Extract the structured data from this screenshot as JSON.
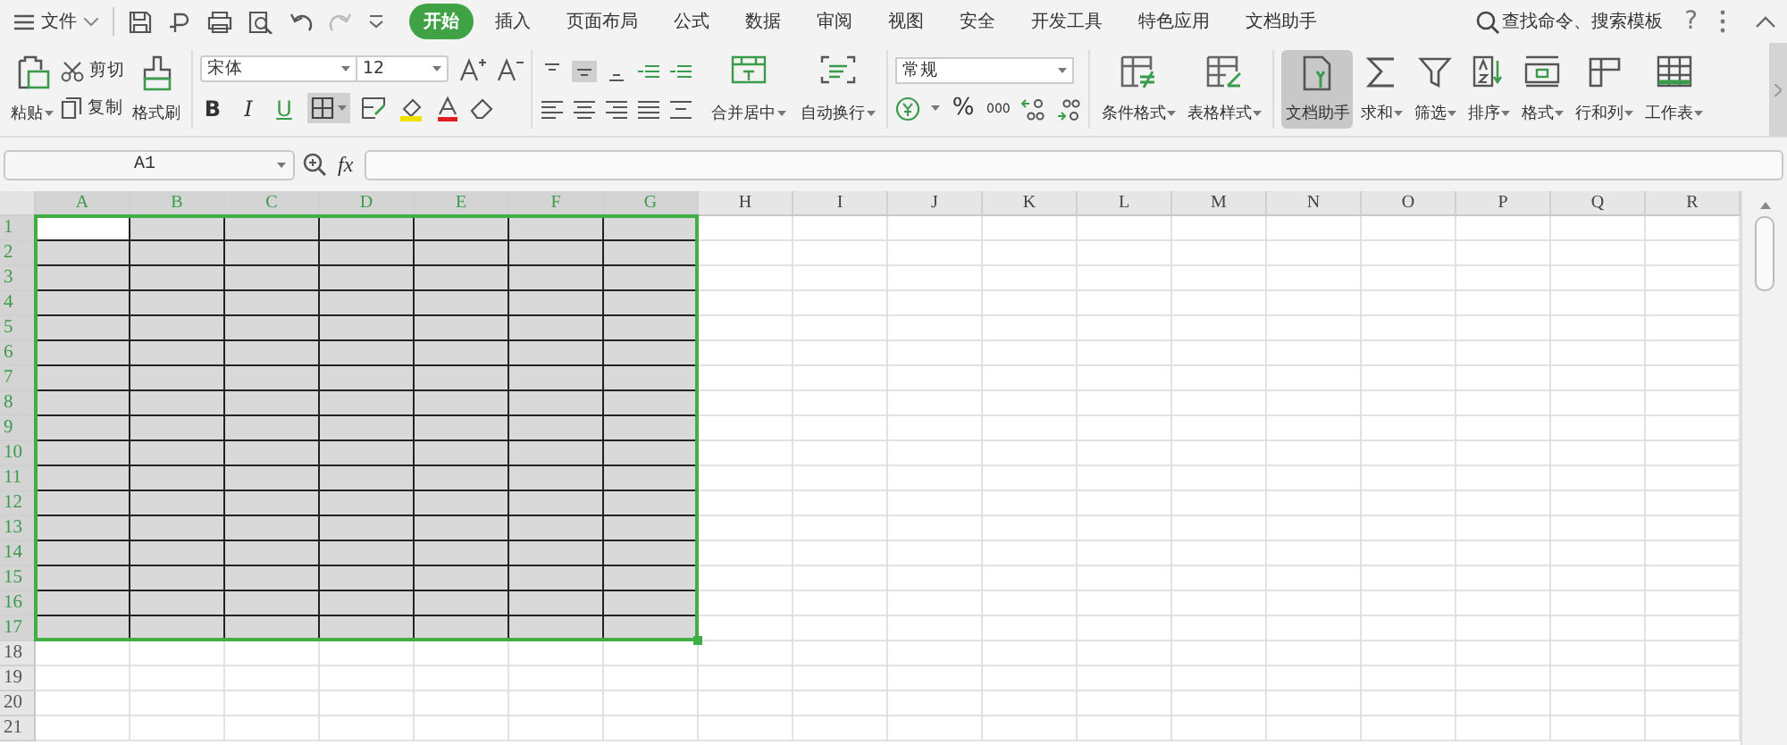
{
  "menu": {
    "label": "文件"
  },
  "tabs": [
    {
      "label": "开始",
      "selected": true
    },
    {
      "label": "插入",
      "selected": false
    },
    {
      "label": "页面布局",
      "selected": false
    },
    {
      "label": "公式",
      "selected": false
    },
    {
      "label": "数据",
      "selected": false
    },
    {
      "label": "审阅",
      "selected": false
    },
    {
      "label": "视图",
      "selected": false
    },
    {
      "label": "安全",
      "selected": false
    },
    {
      "label": "开发工具",
      "selected": false
    },
    {
      "label": "特色应用",
      "selected": false
    },
    {
      "label": "文档助手",
      "selected": false
    }
  ],
  "search": {
    "label": "查找命令、搜索模板"
  },
  "help": "?",
  "clipboard": {
    "paste": "粘贴",
    "cut": "剪切",
    "copy": "复制",
    "painter": "格式刷"
  },
  "font": {
    "name": "宋体",
    "size": "12",
    "bold": "B",
    "italic": "I",
    "underline": "U"
  },
  "alignment": {
    "merge": "合并居中",
    "wrap": "自动换行"
  },
  "number": {
    "format": "常规",
    "percent": "%",
    "thousands": "000"
  },
  "tools": [
    {
      "kind": "conditional",
      "label": "条件格式",
      "selected": false
    },
    {
      "kind": "tablestyle",
      "label": "表格样式",
      "selected": false
    },
    {
      "kind": "assistant",
      "label": "文档助手",
      "selected": true
    },
    {
      "kind": "sum",
      "label": "求和",
      "selected": false
    },
    {
      "kind": "filter",
      "label": "筛选",
      "selected": false
    },
    {
      "kind": "sort",
      "label": "排序",
      "selected": false
    },
    {
      "kind": "format",
      "label": "格式",
      "selected": false
    },
    {
      "kind": "rowcol",
      "label": "行和列",
      "selected": false
    },
    {
      "kind": "sheet",
      "label": "工作表",
      "selected": false
    }
  ],
  "name_box": "A1",
  "fx": "fx",
  "columns": [
    {
      "label": "A",
      "selected": true,
      "active": true
    },
    {
      "label": "B",
      "selected": true,
      "active": false
    },
    {
      "label": "C",
      "selected": true,
      "active": false
    },
    {
      "label": "D",
      "selected": true,
      "active": false
    },
    {
      "label": "E",
      "selected": true,
      "active": false
    },
    {
      "label": "F",
      "selected": true,
      "active": false
    },
    {
      "label": "G",
      "selected": true,
      "active": false
    },
    {
      "label": "H",
      "selected": false,
      "active": false
    },
    {
      "label": "I",
      "selected": false,
      "active": false
    },
    {
      "label": "J",
      "selected": false,
      "active": false
    },
    {
      "label": "K",
      "selected": false,
      "active": false
    },
    {
      "label": "L",
      "selected": false,
      "active": false
    },
    {
      "label": "M",
      "selected": false,
      "active": false
    },
    {
      "label": "N",
      "selected": false,
      "active": false
    },
    {
      "label": "O",
      "selected": false,
      "active": false
    },
    {
      "label": "P",
      "selected": false,
      "active": false
    },
    {
      "label": "Q",
      "selected": false,
      "active": false
    },
    {
      "label": "R",
      "selected": false,
      "active": false
    }
  ],
  "rows": [
    {
      "label": "1",
      "selected": true,
      "active": true
    },
    {
      "label": "2",
      "selected": true,
      "active": false
    },
    {
      "label": "3",
      "selected": true,
      "active": false
    },
    {
      "label": "4",
      "selected": true,
      "active": false
    },
    {
      "label": "5",
      "selected": true,
      "active": false
    },
    {
      "label": "6",
      "selected": true,
      "active": false
    },
    {
      "label": "7",
      "selected": true,
      "active": false
    },
    {
      "label": "8",
      "selected": true,
      "active": false
    },
    {
      "label": "9",
      "selected": true,
      "active": false
    },
    {
      "label": "10",
      "selected": true,
      "active": false
    },
    {
      "label": "11",
      "selected": true,
      "active": false
    },
    {
      "label": "12",
      "selected": true,
      "active": false
    },
    {
      "label": "13",
      "selected": true,
      "active": false
    },
    {
      "label": "14",
      "selected": true,
      "active": false
    },
    {
      "label": "15",
      "selected": true,
      "active": false
    },
    {
      "label": "16",
      "selected": true,
      "active": false
    },
    {
      "label": "17",
      "selected": true,
      "active": false
    },
    {
      "label": "18",
      "selected": false,
      "active": false
    },
    {
      "label": "19",
      "selected": false,
      "active": false
    },
    {
      "label": "20",
      "selected": false,
      "active": false
    },
    {
      "label": "21",
      "selected": false,
      "active": false
    }
  ]
}
